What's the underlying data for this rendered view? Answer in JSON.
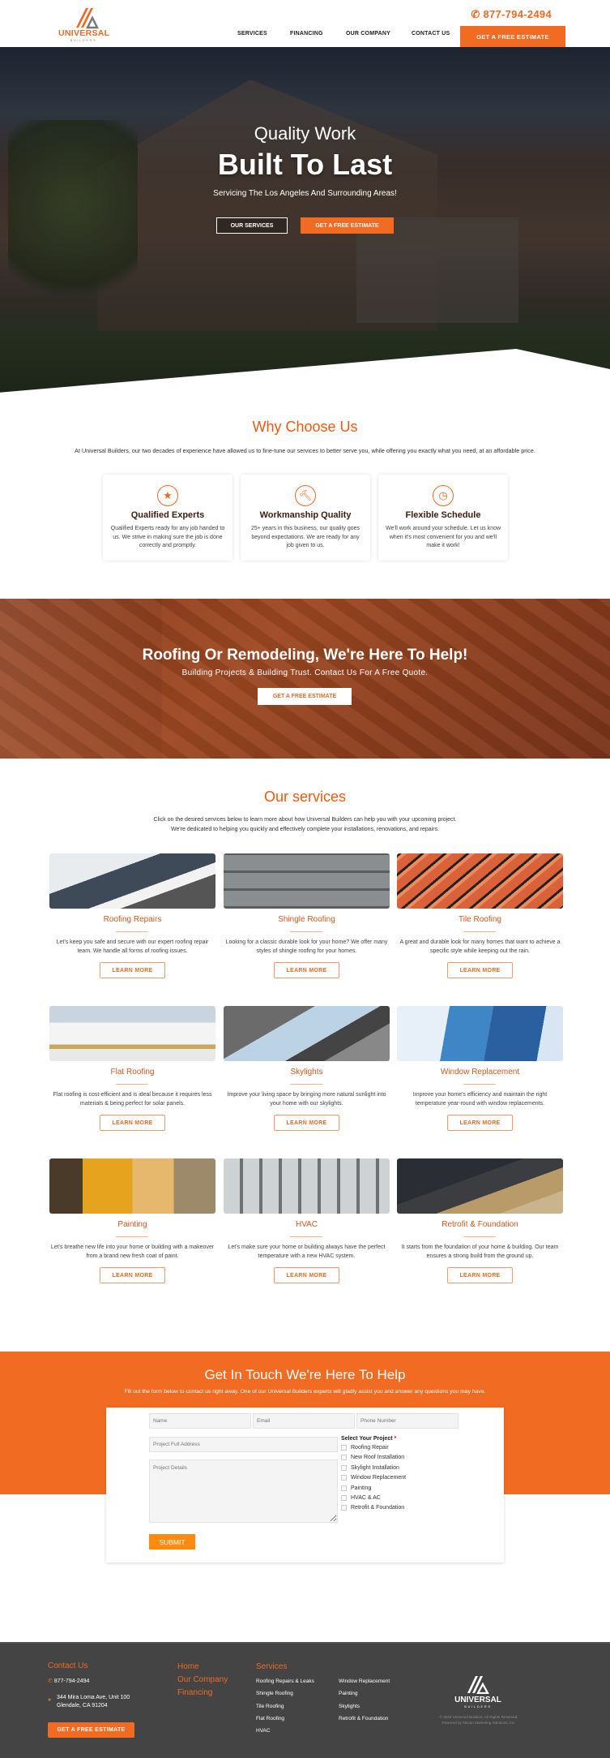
{
  "header": {
    "logo_word": "UNIVERSAL",
    "logo_sub": "BUILDERS",
    "phone": "877-794-2494",
    "nav": [
      "SERVICES",
      "FINANCING",
      "OUR COMPANY",
      "CONTACT US"
    ],
    "cta": "GET A FREE ESTIMATE",
    "accent": "#f26b23"
  },
  "hero": {
    "line1": "Quality Work",
    "line2": "Built To Last",
    "tagline": "Servicing The Los Angeles And Surrounding Areas!",
    "btn_services": "OUR SERVICES",
    "btn_estimate": "GET A FREE ESTIMATE"
  },
  "why": {
    "title": "Why Choose Us",
    "intro": "At Universal Builders, our two decades of experience have allowed us to fine-tune our services to better serve you, while offering you exactly what you need, at an affordable price.",
    "cards": [
      {
        "icon": "star-icon",
        "title": "Qualified Experts",
        "text": "Qualified Experts ready for any job handed to us. We strive in making sure the job is done correctly and promptly."
      },
      {
        "icon": "hammer-icon",
        "title": "Workmanship Quality",
        "text": "25+ years in this business, our quality goes beyond expectations. We are ready for any job given to us."
      },
      {
        "icon": "clock-icon",
        "title": "Flexible Schedule",
        "text": "We'll work around your schedule. Let us know when it's most convenient for you and we'll make it work!"
      }
    ]
  },
  "cta_band": {
    "title": "Roofing Or Remodeling, We're Here To Help!",
    "subtitle": "Building Projects & Building Trust. Contact Us For A Free Quote.",
    "button": "GET A FREE ESTIMATE"
  },
  "services": {
    "title": "Our services",
    "intro1": "Click on the desired services below to learn more about how Universal Builders can help you with your upcoming project.",
    "intro2": "We're dedicated to helping you quickly and effectively complete your installations, renovations, and repairs.",
    "learn_more": "LEARN MORE",
    "items": [
      {
        "title": "Roofing Repairs",
        "text": "Let's keep you safe and secure with our expert roofing repair team. We handle all forms of roofing issues."
      },
      {
        "title": "Shingle Roofing",
        "text": "Looking for a classic durable look for your home? We offer many styles of shingle roofing for your homes."
      },
      {
        "title": "Tile Roofing",
        "text": "A great and durable look for many homes that want to achieve a specific style while keeping out the rain."
      },
      {
        "title": "Flat Roofing",
        "text": "Flat roofing is cost-efficient and is ideal because it requires less materials & being perfect for solar panels."
      },
      {
        "title": "Skylights",
        "text": "Improve your living space by bringing more natural sunlight into your home with our skylights."
      },
      {
        "title": "Window Replacement",
        "text": "Improve your home's efficiency and maintain the right temperature year-round with window replacements."
      },
      {
        "title": "Painting",
        "text": "Let's breathe new life into your home or building with a makeover from a brand new fresh coat of paint."
      },
      {
        "title": "HVAC",
        "text": "Let's make sure your home or building always have the perfect temperature with a new HVAC system."
      },
      {
        "title": "Retrofit & Foundation",
        "text": "It starts from the foundation of your home & building. Our team ensures a strong build from the ground up."
      }
    ]
  },
  "contact": {
    "title": "Get In Touch We're Here To Help",
    "subtitle": "Fill out the form below to contact us right away. One of our Universal Builders experts will gladly assist you and answer any questions you may have.",
    "placeholders": {
      "name": "Name",
      "email": "Email",
      "phone": "Phone Number",
      "address": "Project Full Address",
      "details": "Project Details"
    },
    "select_label": "Select Your Project",
    "required_mark": "*",
    "options": [
      "Roofing Repair",
      "New Roof Installation",
      "Skylight Installation",
      "Window Replacement",
      "Painting",
      "HVAC & AC",
      "Retrofit & Foundation"
    ],
    "submit": "SUBMIT"
  },
  "footer": {
    "contact_title": "Contact Us",
    "phone": "877-794-2494",
    "address1": "344 Mira Loma Ave, Unit 100",
    "address2": "Glendale, CA 91204",
    "cta": "GET A FREE ESTIMATE",
    "links": [
      "Home",
      "Our Company",
      "Financing"
    ],
    "services_title": "Services",
    "services_col1": [
      "Roofing Repairs & Leaks",
      "Shingle Roofing",
      "Tile Roofing",
      "Flat Roofing",
      "HVAC"
    ],
    "services_col2": [
      "Window Replacement",
      "Painting",
      "Skylights",
      "Retrofit & Foundation"
    ],
    "logo_word": "UNIVERSAL",
    "logo_sub": "BUILDERS",
    "copyright": "© 2022 Universal Builders. All Rights Reserved.",
    "powered": "Powered by Alecan Marketing Solutions, Inc."
  }
}
